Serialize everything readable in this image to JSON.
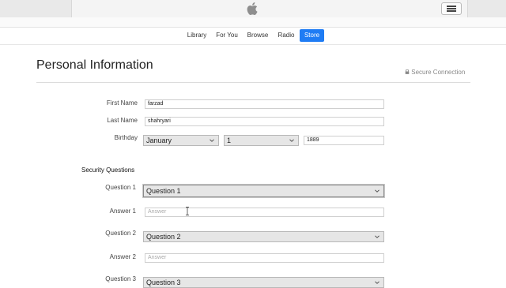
{
  "nav": {
    "tabs": [
      {
        "label": "Library",
        "active": false
      },
      {
        "label": "For You",
        "active": false
      },
      {
        "label": "Browse",
        "active": false
      },
      {
        "label": "Radio",
        "active": false
      },
      {
        "label": "Store",
        "active": true
      }
    ]
  },
  "page": {
    "title": "Personal Information",
    "secure": "Secure Connection"
  },
  "form": {
    "first_name": {
      "label": "First Name",
      "value": "farzad"
    },
    "last_name": {
      "label": "Last Name",
      "value": "shahryari"
    },
    "birthday": {
      "label": "Birthday",
      "month": "January",
      "day": "1",
      "year": "1889"
    },
    "security": {
      "heading": "Security Questions",
      "q1": {
        "label": "Question 1",
        "value": "Question 1"
      },
      "a1": {
        "label": "Answer 1",
        "placeholder": "Answer"
      },
      "q2": {
        "label": "Question 2",
        "value": "Question 2"
      },
      "a2": {
        "label": "Answer 2",
        "placeholder": "Answer"
      },
      "q3": {
        "label": "Question 3",
        "value": "Question 3"
      }
    }
  },
  "colors": {
    "accent": "#1f7cf4"
  },
  "icons": [
    "apple-logo-icon",
    "list-icon",
    "lock-icon",
    "chevron-down-icon",
    "text-cursor-icon"
  ]
}
